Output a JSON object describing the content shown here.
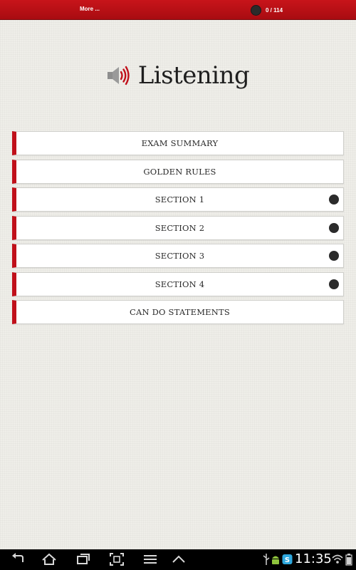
{
  "topbar": {
    "more_label": "More ...",
    "progress_text": "0 / 114"
  },
  "header": {
    "title": "Listening",
    "icon": "speaker-icon"
  },
  "menu": {
    "items": [
      {
        "label": "EXAM SUMMARY",
        "status_dot": false
      },
      {
        "label": "GOLDEN RULES",
        "status_dot": false
      },
      {
        "label": "SECTION 1",
        "status_dot": true
      },
      {
        "label": "SECTION 2",
        "status_dot": true
      },
      {
        "label": "SECTION 3",
        "status_dot": true
      },
      {
        "label": "SECTION 4",
        "status_dot": true
      },
      {
        "label": "CAN DO STATEMENTS",
        "status_dot": false
      }
    ]
  },
  "system_bar": {
    "clock": "11:35",
    "nav_icons": [
      "back-icon",
      "home-icon",
      "recent-apps-icon",
      "screenshot-icon",
      "menu-icon",
      "up-arrow-icon"
    ],
    "status_icons": [
      "usb-icon",
      "android-debug-icon",
      "skype-icon",
      "wifi-icon",
      "battery-icon"
    ]
  },
  "colors": {
    "accent_red": "#c0101a",
    "topbar_red": "#b80f15",
    "background": "#efeee9"
  }
}
